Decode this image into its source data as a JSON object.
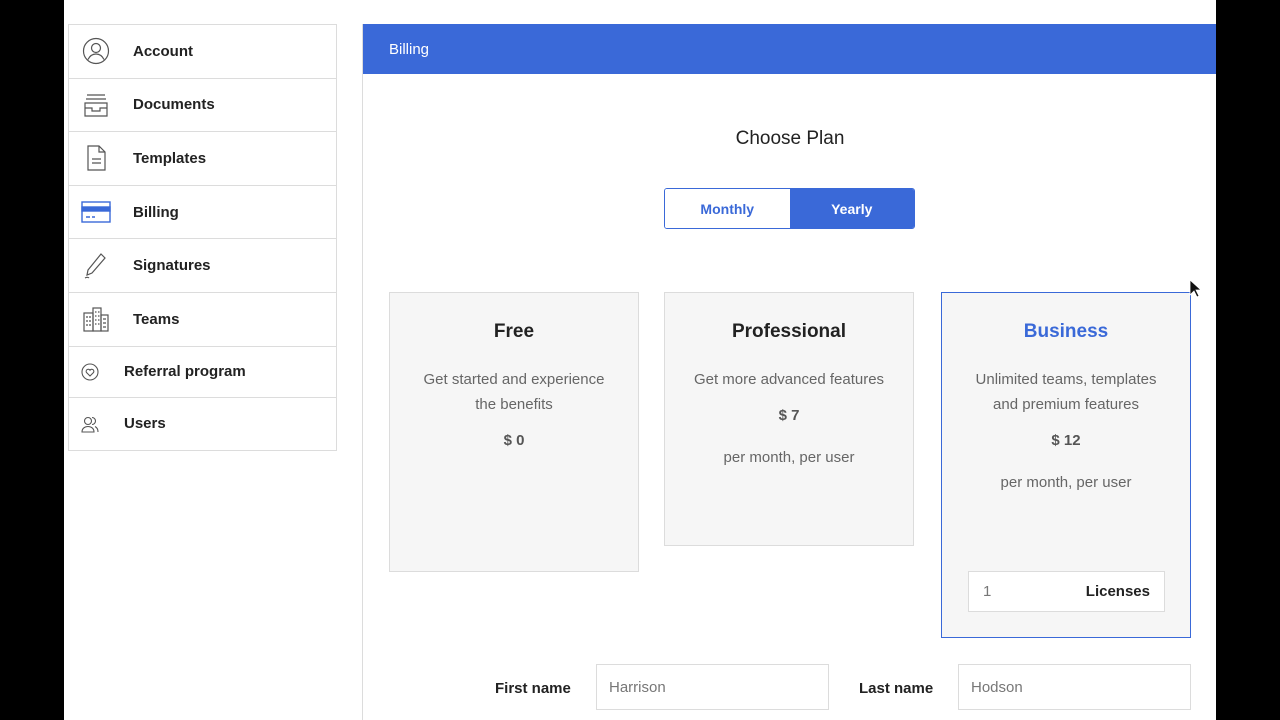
{
  "sidebar": {
    "items": [
      {
        "label": "Account",
        "icon": "user-circle-icon"
      },
      {
        "label": "Documents",
        "icon": "inbox-tray-icon"
      },
      {
        "label": "Templates",
        "icon": "document-icon"
      },
      {
        "label": "Billing",
        "icon": "credit-card-icon"
      },
      {
        "label": "Signatures",
        "icon": "pen-icon"
      },
      {
        "label": "Teams",
        "icon": "buildings-icon"
      },
      {
        "label": "Referral program",
        "icon": "heart-badge-icon"
      },
      {
        "label": "Users",
        "icon": "users-icon"
      }
    ]
  },
  "main": {
    "header": "Billing",
    "title": "Choose Plan",
    "toggle": {
      "monthly": "Monthly",
      "yearly": "Yearly",
      "selected": "Yearly"
    },
    "plans": [
      {
        "name": "Free",
        "description": "Get started and experience the benefits",
        "price": "$ 0",
        "per": ""
      },
      {
        "name": "Professional",
        "description": "Get more advanced features",
        "price": "$ 7",
        "per": "per month, per user"
      },
      {
        "name": "Business",
        "description": "Unlimited teams, templates and premium features",
        "price": "$ 12",
        "per": "per month, per user",
        "licenses_value": "1",
        "licenses_label": "Licenses"
      }
    ],
    "form": {
      "first_name_label": "First name",
      "first_name_value": "Harrison",
      "last_name_label": "Last name",
      "last_name_value": "Hodson"
    }
  },
  "colors": {
    "accent": "#3a69d8",
    "border": "#dcdcdc",
    "card_bg": "#f6f6f6"
  }
}
